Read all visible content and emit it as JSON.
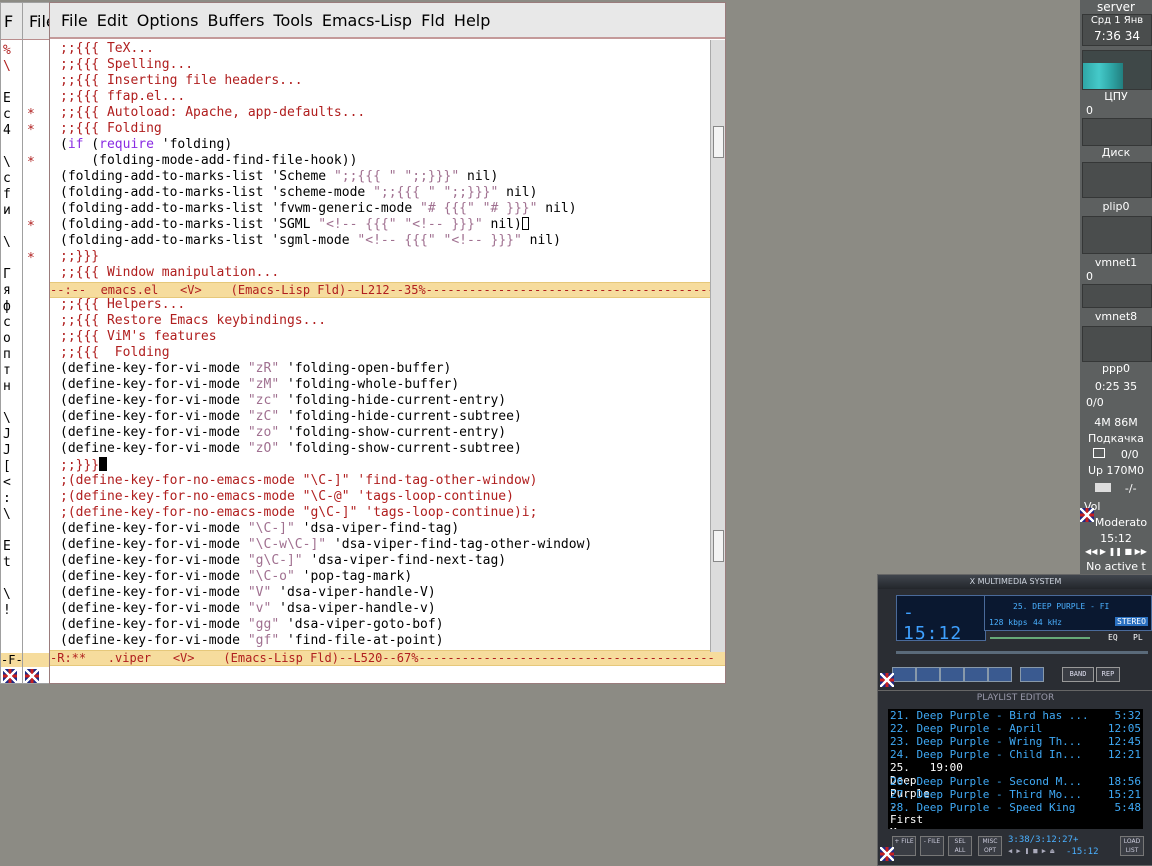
{
  "menubar": {
    "items": [
      "File",
      "Edit",
      "Options",
      "Buffers",
      "Tools",
      "Emacs-Lisp",
      "Fld",
      "Help"
    ]
  },
  "bg_frames": {
    "frame1_menu": "F",
    "frame2_menu": "File",
    "frame1_mode": "-F-R:",
    "frame2_mode": "-R:**"
  },
  "top_pane": {
    "lines": [
      [
        ";;{{{ TeX..."
      ],
      [
        ";;{{{ Spelling..."
      ],
      [
        ";;{{{ Inserting file headers..."
      ],
      [
        ";;{{{ ffap.el..."
      ],
      [
        ";;{{{ Autoload: Apache, app-defaults..."
      ],
      [
        ";;{{{ Folding"
      ],
      [
        "(if (require 'folding)"
      ],
      [
        "    (folding-mode-add-find-file-hook))"
      ],
      [
        "(folding-add-to-marks-list 'Scheme \";;{{{ \" \";;}}}\" nil)"
      ],
      [
        "(folding-add-to-marks-list 'scheme-mode \";;{{{ \" \";;}}}\" nil)"
      ],
      [
        "(folding-add-to-marks-list 'fvwm-generic-mode \"# {{{\" \"# }}}\" nil)"
      ],
      [
        "(folding-add-to-marks-list 'SGML \"<!-- {{{\" \"<!-- }}}\" nil)"
      ],
      [
        "(folding-add-to-marks-list 'sgml-mode \"<!-- {{{\" \"<!-- }}}\" nil)"
      ],
      [
        ";;}}}"
      ],
      [
        ";;{{{ Window manipulation..."
      ]
    ],
    "modeline": "--:--  emacs.el   <V>    (Emacs-Lisp Fld)--L212--35%-----------------------------------------"
  },
  "bottom_pane": {
    "lines": [
      [
        ";;{{{ Helpers..."
      ],
      [
        ";;{{{ Restore Emacs keybindings..."
      ],
      [
        ";;{{{ ViM's features"
      ],
      [
        ";;{{{  Folding"
      ],
      [
        "(define-key-for-vi-mode \"zR\" 'folding-open-buffer)"
      ],
      [
        "(define-key-for-vi-mode \"zM\" 'folding-whole-buffer)"
      ],
      [
        "(define-key-for-vi-mode \"zc\" 'folding-hide-current-entry)"
      ],
      [
        "(define-key-for-vi-mode \"zC\" 'folding-hide-current-subtree)"
      ],
      [
        "(define-key-for-vi-mode \"zo\" 'folding-show-current-entry)"
      ],
      [
        "(define-key-for-vi-mode \"zO\" 'folding-show-current-subtree)"
      ],
      [
        ";;}}}"
      ],
      [
        ";(define-key-for-no-emacs-mode \"\\C-]\" 'find-tag-other-window)"
      ],
      [
        ";(define-key-for-no-emacs-mode \"\\C-@\" 'tags-loop-continue)"
      ],
      [
        ";(define-key-for-no-emacs-mode \"g\\C-]\" 'tags-loop-continue)i;"
      ],
      [
        "(define-key-for-vi-mode \"\\C-]\" 'dsa-viper-find-tag)"
      ],
      [
        "(define-key-for-vi-mode \"\\C-w\\C-]\" 'dsa-viper-find-tag-other-window)"
      ],
      [
        "(define-key-for-vi-mode \"g\\C-]\" 'dsa-viper-find-next-tag)"
      ],
      [
        "(define-key-for-vi-mode \"\\C-o\" 'pop-tag-mark)"
      ],
      [
        "(define-key-for-vi-mode \"V\" 'dsa-viper-handle-V)"
      ],
      [
        "(define-key-for-vi-mode \"v\" 'dsa-viper-handle-v)"
      ],
      [
        "(define-key-for-vi-mode \"gg\" 'dsa-viper-goto-bof)"
      ],
      [
        "(define-key-for-vi-mode \"gf\" 'find-file-at-point)"
      ]
    ],
    "modeline": "-R:**   .viper   <V>    (Emacs-Lisp Fld)--L520--67%-----------------------------------------"
  },
  "gkrellm": {
    "host": "server",
    "date": "Срд 1 Янв",
    "time": "7:36 34",
    "cpu": "ЦПУ",
    "cpu_val": "0",
    "disk": "Диск",
    "net1": "plip0",
    "net2": "vmnet1",
    "net2_val": "0",
    "net3": "vmnet8",
    "net4": "ppp0",
    "ppp_time": "0:25 35",
    "ppp_val": "0/0",
    "mem": "4M",
    "mem2": "86M",
    "mail_label": "Подкачка",
    "mail_count": "0/0",
    "uptime": "Up 170M0",
    "clock_dash": "-/-",
    "vol": "Vol",
    "track": "Moderato",
    "track_time": "15:12",
    "status": "No active t"
  },
  "xmms": {
    "title": "X MULTIMEDIA SYSTEM",
    "time": "- 15:12",
    "song": "25. DEEP PURPLE - FI",
    "kbps": "128 kbps",
    "khz": "44 kHz",
    "stereo": "STEREO",
    "eq": "EQ",
    "pl": "PL",
    "band": "BAND",
    "rep": "REP"
  },
  "playlist": {
    "title": "PLAYLIST EDITOR",
    "items": [
      {
        "name": "21. Deep Purple - Bird has ...",
        "time": "5:32"
      },
      {
        "name": "22. Deep Purple - April",
        "time": "12:05"
      },
      {
        "name": "23. Deep Purple - Wring Th...",
        "time": "12:45"
      },
      {
        "name": "24. Deep Purple - Child In...",
        "time": "12:21"
      },
      {
        "name": "25. Deep Purple - First Mo...",
        "time": "19:00"
      },
      {
        "name": "26. Deep Purple - Second M...",
        "time": "18:56"
      },
      {
        "name": "27. Deep Purple - Third Mo...",
        "time": "15:21"
      },
      {
        "name": "28. Deep Purple - Speed King",
        "time": "5:48"
      }
    ],
    "current_index": 4,
    "buttons": [
      "+ FILE",
      "- FILE",
      "SEL ALL",
      "MISC OPT",
      "LOAD LIST"
    ],
    "info": "3:38/3:12:27+",
    "time": "-15:12"
  },
  "colors": {
    "comment": "#b01e1e",
    "keyword": "#8a2be2",
    "string": "#a07090",
    "modeline_bg": "#f6dc9d"
  }
}
